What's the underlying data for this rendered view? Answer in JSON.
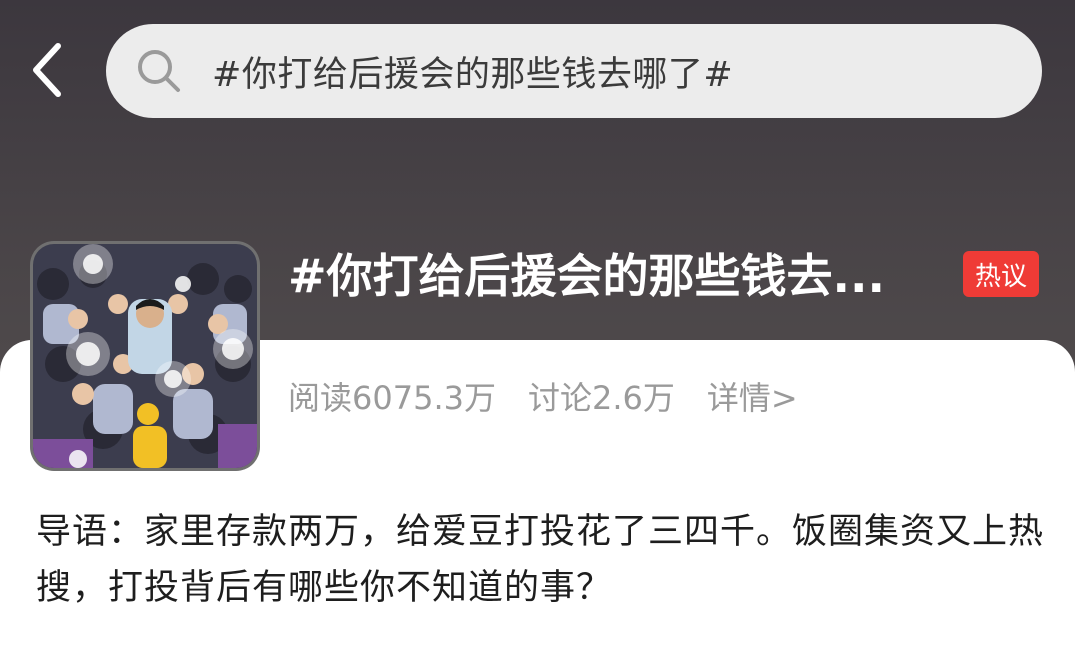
{
  "search": {
    "query": "#你打给后援会的那些钱去哪了#"
  },
  "topic": {
    "title": "#你打给后援会的那些钱去...",
    "badge": "热议",
    "reads": "阅读6075.3万",
    "discussions": "讨论2.6万",
    "details": "详情>"
  },
  "intro": {
    "text": "导语：家里存款两万，给爱豆打投花了三四千。饭圈集资又上热搜，打投背后有哪些你不知道的事？"
  },
  "icons": {
    "back": "chevron-left-icon",
    "search": "search-icon"
  },
  "colors": {
    "badge": "#ef3b36",
    "header": "#4a4548"
  }
}
